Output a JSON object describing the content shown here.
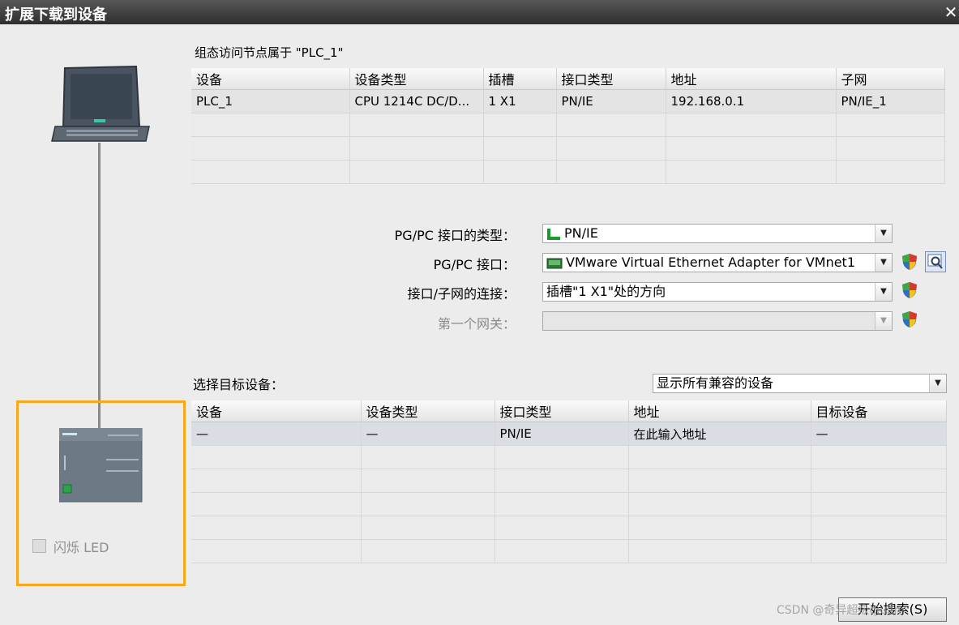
{
  "window": {
    "title": "扩展下载到设备",
    "close_icon": "close-icon"
  },
  "configured": {
    "label": "组态访问节点属于 \"PLC_1\"",
    "columns": [
      "设备",
      "设备类型",
      "插槽",
      "接口类型",
      "地址",
      "子网"
    ],
    "rows": [
      [
        "PLC_1",
        "CPU 1214C DC/D...",
        "1 X1",
        "PN/IE",
        "192.168.0.1",
        "PN/IE_1"
      ]
    ]
  },
  "form": {
    "pgpc_type_label": "PG/PC 接口的类型：",
    "pgpc_type_value": "PN/IE",
    "pgpc_iface_label": "PG/PC 接口：",
    "pgpc_iface_value": "VMware Virtual Ethernet Adapter for VMnet1",
    "subnet_conn_label": "接口/子网的连接：",
    "subnet_conn_value": "插槽\"1 X1\"处的方向",
    "gateway_label": "第一个网关：",
    "gateway_value": ""
  },
  "target": {
    "label": "选择目标设备：",
    "filter_value": "显示所有兼容的设备",
    "columns": [
      "设备",
      "设备类型",
      "接口类型",
      "地址",
      "目标设备"
    ],
    "rows": [
      [
        "—",
        "—",
        "PN/IE",
        "在此输入地址",
        "—"
      ]
    ]
  },
  "left_panel": {
    "flash_led_label": "闪烁 LED",
    "flash_led_checked": false
  },
  "start_search_button": "开始搜索(S)",
  "watermark": "CSDN @奇异超级qiuan",
  "colors": {
    "highlight_border": "#f7a81b",
    "title_bar": "#2e2e2e"
  }
}
